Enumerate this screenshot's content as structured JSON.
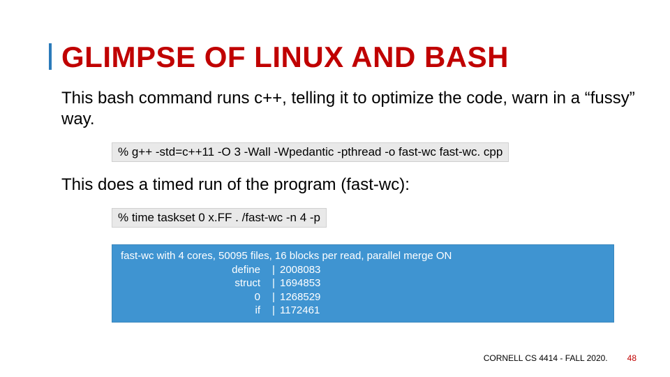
{
  "title": "GLIMPSE OF LINUX AND BASH",
  "p1": "This bash command runs c++, telling it to optimize the code, warn in a “fussy” way.",
  "cmd1": "% g++ -std=c++11  -O 3 -Wall -Wpedantic -pthread  -o fast-wc fast-wc. cpp",
  "p2": "This does a timed run of the program (fast-wc):",
  "cmd2": "% time taskset 0 x.FF . /fast-wc -n 4 -p",
  "output": {
    "header": "fast-wc with 4 cores, 50095 files, 16 blocks per read, parallel merge ON",
    "rows": [
      {
        "label": "define",
        "value": "2008083"
      },
      {
        "label": "struct",
        "value": "1694853"
      },
      {
        "label": "0",
        "value": "1268529"
      },
      {
        "label": "if",
        "value": "1172461"
      }
    ],
    "sep": "|"
  },
  "footer": "CORNELL CS 4414 - FALL 2020.",
  "page_num": "48"
}
